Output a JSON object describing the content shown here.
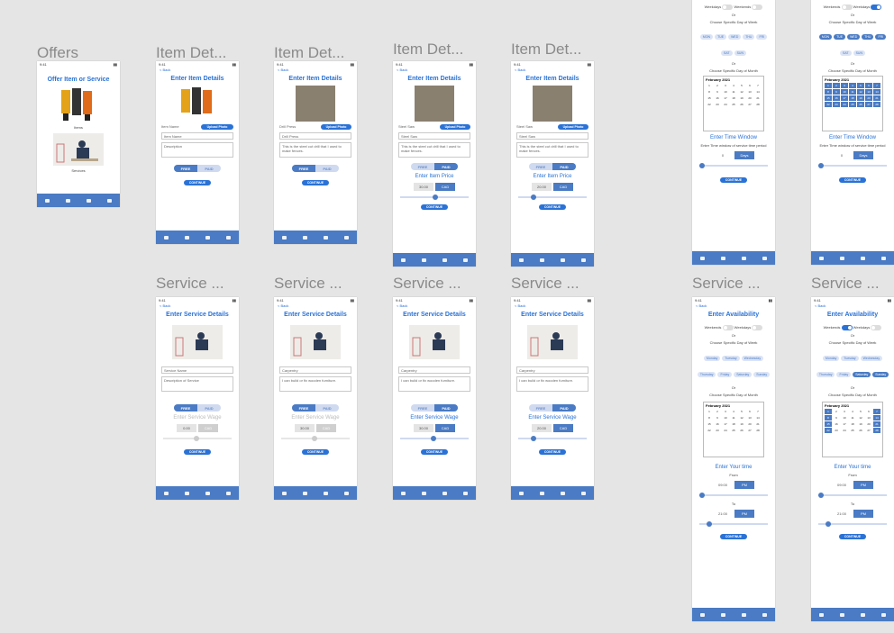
{
  "labels": {
    "offers": "Offers",
    "item_details_1": "Item Det...",
    "item_details_2": "Item Det...",
    "item_details_3": "Item Det...",
    "item_details_4": "Item Det...",
    "service_1": "Service ...",
    "service_2": "Service ...",
    "service_3": "Service ...",
    "service_4": "Service ...",
    "service_5": "Service ...",
    "service_6": "Service ..."
  },
  "offers_screen": {
    "title": "Offer Item or Service",
    "item_label": "Items",
    "service_label": "Services"
  },
  "item": {
    "back": "< Back",
    "title": "Enter Item Details",
    "upload": "Upload Photo",
    "name_placeholder": "Item Name",
    "desc_placeholder": "Description",
    "name_value": "Drill Press",
    "name_value2": "Steel Saw",
    "desc_value": "This is the steel cut drill that I used to make fences.",
    "free": "FREE",
    "paid": "PAID",
    "price_title": "Enter Item Price",
    "price": "30.00",
    "price2": "20.00",
    "currency": "CAD",
    "continue": "CONTINUE"
  },
  "service": {
    "back": "< Back",
    "title": "Enter Service Details",
    "name_placeholder": "Service Name",
    "desc_placeholder": "Description of Service",
    "name_value": "Carpentry",
    "desc_value": "I can build or fix wooden furniture.",
    "wage_title": "Enter Service Wage",
    "wage": "0.00",
    "wage2": "30.00",
    "wage3": "20.00",
    "currency": "CAD",
    "continue": "CONTINUE",
    "free": "FREE",
    "paid": "PAID"
  },
  "availability": {
    "title": "Enter Availability",
    "weekends": "Weekends",
    "weekdays": "Weekdays",
    "or": "Or",
    "week_label": "Choose Specific Day of Week",
    "month_label": "Choose Specific Day of Month",
    "month": "February 2021",
    "days_short": [
      "MON",
      "TUE",
      "WED",
      "THU",
      "FRI",
      "SAT",
      "SUN"
    ],
    "days_full": [
      "Monday",
      "Tuesday",
      "Wednesday",
      "Thursday",
      "Friday",
      "Saturday",
      "Sunday"
    ],
    "time_window": "Enter Time Window",
    "time_window_sub": "Enter Time window of service time period",
    "window_value": "0",
    "window_unit": "Days",
    "your_time": "Enter Your time",
    "from": "From",
    "to": "To",
    "from_time": "09:00",
    "to_time": "21:00",
    "pm": "PM",
    "continue": "CONTINUE"
  },
  "colors": {
    "accent": "#2a72d6",
    "nav": "#4a7bc4",
    "bg": "#e5e5e5"
  }
}
